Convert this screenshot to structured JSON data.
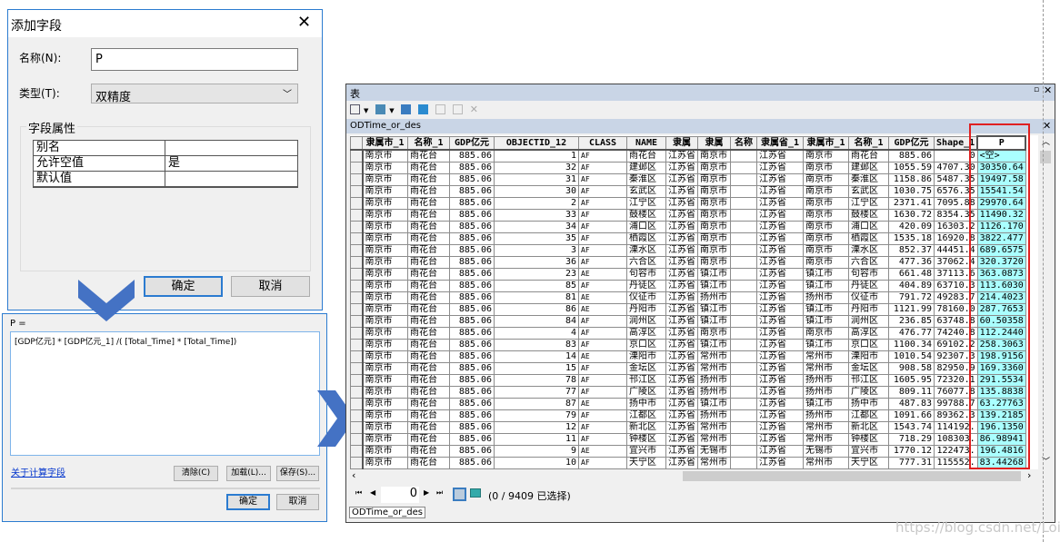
{
  "add_field_dialog": {
    "title": "添加字段",
    "name_label": "名称(N):",
    "name_value": "P",
    "type_label": "类型(T):",
    "type_value": "双精度",
    "group_label": "字段属性",
    "properties": [
      {
        "key": "别名",
        "value": ""
      },
      {
        "key": "允许空值",
        "value": "是"
      },
      {
        "key": "默认值",
        "value": ""
      }
    ],
    "ok": "确定",
    "cancel": "取消"
  },
  "calc_dialog": {
    "expr_label": "P =",
    "expression": "[GDP亿元] * [GDP亿元_1] /( [Total_Time] * [Total_Time])",
    "help_link": "关于计算字段",
    "clear": "清除(C)",
    "load": "加载(L)...",
    "save": "保存(S)...",
    "ok": "确定",
    "cancel": "取消"
  },
  "table_window": {
    "title": "表",
    "tab_title": "ODTime_or_des",
    "bottom_tab": "ODTime_or_des",
    "record_value": "0",
    "selection_status": "(0 / 9409 已选择)",
    "columns": [
      "隶属市_1",
      "名称_1",
      "GDP亿元",
      "OBJECTID_12",
      "CLASS",
      "NAME",
      "隶属",
      "隶属",
      "名称",
      "隶属省_1",
      "隶属市_1",
      "名称_1",
      "GDP亿元",
      "Shape_1",
      "P"
    ],
    "rows": [
      [
        "南京市",
        "雨花台",
        "885.06",
        "1",
        "AF",
        "雨花台",
        "江苏省",
        "南京市",
        "",
        "江苏省",
        "南京市",
        "雨花台",
        "885.06",
        "0",
        "<空>"
      ],
      [
        "南京市",
        "雨花台",
        "885.06",
        "32",
        "AF",
        "建邺区",
        "江苏省",
        "南京市",
        "",
        "江苏省",
        "南京市",
        "建邺区",
        "1055.59",
        "4707.30",
        "30350.64"
      ],
      [
        "南京市",
        "雨花台",
        "885.06",
        "31",
        "AF",
        "秦淮区",
        "江苏省",
        "南京市",
        "",
        "江苏省",
        "南京市",
        "秦淮区",
        "1158.86",
        "5487.35",
        "19497.58"
      ],
      [
        "南京市",
        "雨花台",
        "885.06",
        "30",
        "AF",
        "玄武区",
        "江苏省",
        "南京市",
        "",
        "江苏省",
        "南京市",
        "玄武区",
        "1030.75",
        "6576.35",
        "15541.54"
      ],
      [
        "南京市",
        "雨花台",
        "885.06",
        "2",
        "AF",
        "江宁区",
        "江苏省",
        "南京市",
        "",
        "江苏省",
        "南京市",
        "江宁区",
        "2371.41",
        "7095.88",
        "29970.64"
      ],
      [
        "南京市",
        "雨花台",
        "885.06",
        "33",
        "AF",
        "鼓楼区",
        "江苏省",
        "南京市",
        "",
        "江苏省",
        "南京市",
        "鼓楼区",
        "1630.72",
        "8354.35",
        "11490.32"
      ],
      [
        "南京市",
        "雨花台",
        "885.06",
        "34",
        "AF",
        "浦口区",
        "江苏省",
        "南京市",
        "",
        "江苏省",
        "南京市",
        "浦口区",
        "420.09",
        "16303.2",
        "1126.170"
      ],
      [
        "南京市",
        "雨花台",
        "885.06",
        "35",
        "AF",
        "栖霞区",
        "江苏省",
        "南京市",
        "",
        "江苏省",
        "南京市",
        "栖霞区",
        "1535.18",
        "16920.8",
        "3822.477"
      ],
      [
        "南京市",
        "雨花台",
        "885.06",
        "3",
        "AF",
        "溧水区",
        "江苏省",
        "南京市",
        "",
        "江苏省",
        "南京市",
        "溧水区",
        "852.37",
        "44451.4",
        "689.6575"
      ],
      [
        "南京市",
        "雨花台",
        "885.06",
        "36",
        "AF",
        "六合区",
        "江苏省",
        "南京市",
        "",
        "江苏省",
        "南京市",
        "六合区",
        "477.36",
        "37062.4",
        "320.3720"
      ],
      [
        "南京市",
        "雨花台",
        "885.06",
        "23",
        "AE",
        "句容市",
        "江苏省",
        "镇江市",
        "",
        "江苏省",
        "镇江市",
        "句容市",
        "661.48",
        "37113.6",
        "363.0873"
      ],
      [
        "南京市",
        "雨花台",
        "885.06",
        "85",
        "AF",
        "丹徒区",
        "江苏省",
        "镇江市",
        "",
        "江苏省",
        "镇江市",
        "丹徒区",
        "404.89",
        "63710.3",
        "113.6030"
      ],
      [
        "南京市",
        "雨花台",
        "885.06",
        "81",
        "AE",
        "仪征市",
        "江苏省",
        "扬州市",
        "",
        "江苏省",
        "扬州市",
        "仪征市",
        "791.72",
        "49283.7",
        "214.4023"
      ],
      [
        "南京市",
        "雨花台",
        "885.06",
        "86",
        "AE",
        "丹阳市",
        "江苏省",
        "镇江市",
        "",
        "江苏省",
        "镇江市",
        "丹阳市",
        "1121.99",
        "78160.0",
        "287.7653"
      ],
      [
        "南京市",
        "雨花台",
        "885.06",
        "84",
        "AF",
        "润州区",
        "江苏省",
        "镇江市",
        "",
        "江苏省",
        "镇江市",
        "润州区",
        "236.85",
        "63748.8",
        "60.50358"
      ],
      [
        "南京市",
        "雨花台",
        "885.06",
        "4",
        "AF",
        "高淳区",
        "江苏省",
        "南京市",
        "",
        "江苏省",
        "南京市",
        "高淳区",
        "476.77",
        "74240.8",
        "112.2440"
      ],
      [
        "南京市",
        "雨花台",
        "885.06",
        "83",
        "AF",
        "京口区",
        "江苏省",
        "镇江市",
        "",
        "江苏省",
        "镇江市",
        "京口区",
        "1100.34",
        "69102.2",
        "258.3063"
      ],
      [
        "南京市",
        "雨花台",
        "885.06",
        "14",
        "AE",
        "溧阳市",
        "江苏省",
        "常州市",
        "",
        "江苏省",
        "常州市",
        "溧阳市",
        "1010.54",
        "92307.3",
        "198.9156"
      ],
      [
        "南京市",
        "雨花台",
        "885.06",
        "15",
        "AF",
        "金坛区",
        "江苏省",
        "常州市",
        "",
        "江苏省",
        "常州市",
        "金坛区",
        "908.58",
        "82950.9",
        "169.3360"
      ],
      [
        "南京市",
        "雨花台",
        "885.06",
        "78",
        "AF",
        "邗江区",
        "江苏省",
        "扬州市",
        "",
        "江苏省",
        "扬州市",
        "邗江区",
        "1605.95",
        "72320.1",
        "291.5534"
      ],
      [
        "南京市",
        "雨花台",
        "885.06",
        "77",
        "AF",
        "广陵区",
        "江苏省",
        "扬州市",
        "",
        "江苏省",
        "扬州市",
        "广陵区",
        "809.11",
        "76077.8",
        "135.8838"
      ],
      [
        "南京市",
        "雨花台",
        "885.06",
        "87",
        "AE",
        "扬中市",
        "江苏省",
        "镇江市",
        "",
        "江苏省",
        "镇江市",
        "扬中市",
        "487.83",
        "99788.7",
        "63.27763"
      ],
      [
        "南京市",
        "雨花台",
        "885.06",
        "79",
        "AF",
        "江都区",
        "江苏省",
        "扬州市",
        "",
        "江苏省",
        "扬州市",
        "江都区",
        "1091.66",
        "89362.3",
        "139.2185"
      ],
      [
        "南京市",
        "雨花台",
        "885.06",
        "12",
        "AF",
        "新北区",
        "江苏省",
        "常州市",
        "",
        "江苏省",
        "常州市",
        "新北区",
        "1543.74",
        "114192.",
        "196.1350"
      ],
      [
        "南京市",
        "雨花台",
        "885.06",
        "11",
        "AF",
        "钟楼区",
        "江苏省",
        "常州市",
        "",
        "江苏省",
        "常州市",
        "钟楼区",
        "718.29",
        "108303.",
        "86.98941"
      ],
      [
        "南京市",
        "雨花台",
        "885.06",
        "9",
        "AE",
        "宜兴市",
        "江苏省",
        "无锡市",
        "",
        "江苏省",
        "无锡市",
        "宜兴市",
        "1770.12",
        "122473.",
        "196.4816"
      ],
      [
        "南京市",
        "雨花台",
        "885.06",
        "10",
        "AF",
        "天宁区",
        "江苏省",
        "常州市",
        "",
        "江苏省",
        "常州市",
        "天宁区",
        "777.31",
        "115552.",
        "83.44268"
      ]
    ]
  },
  "watermark": "https://blog.csdn.net/Lois_mery",
  "colors": {
    "arrow": "#4472c4",
    "highlight_box": "#e02020",
    "new_field_bg": "#aaffff",
    "window_title": "#c9d5e6"
  }
}
